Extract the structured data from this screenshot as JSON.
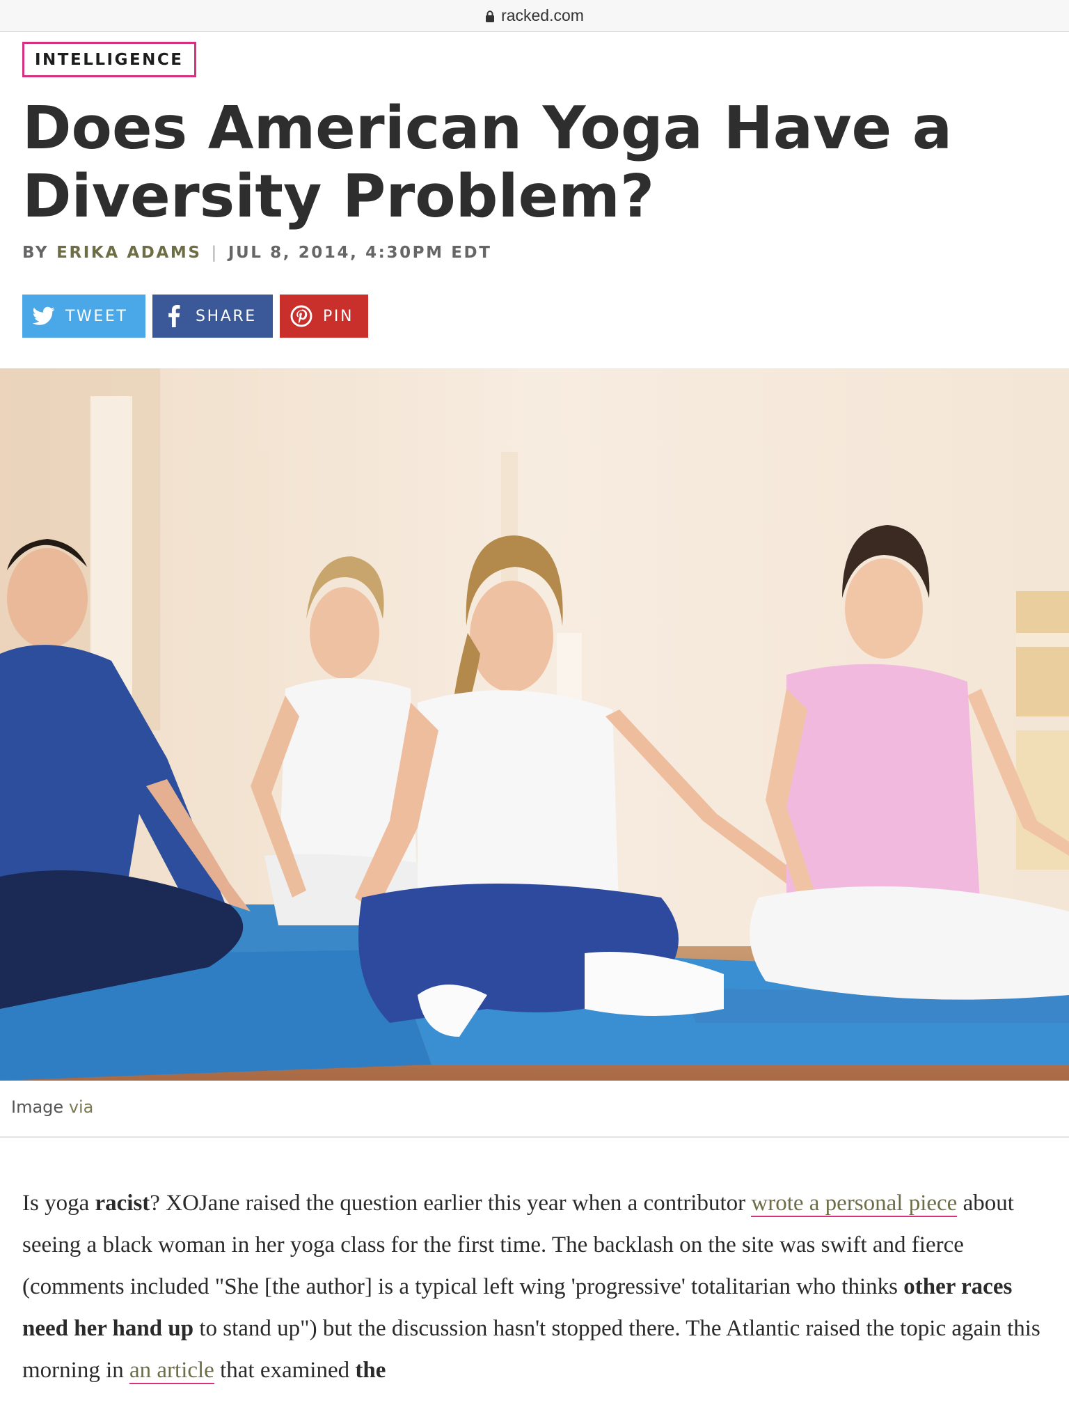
{
  "browser": {
    "url": "racked.com",
    "lock_icon": "lock-icon"
  },
  "article": {
    "category": "INTELLIGENCE",
    "headline": "Does American Yoga Have a Diversity Problem?",
    "byline_prefix": "BY",
    "author": "ERIKA ADAMS",
    "separator": "|",
    "date": "JUL 8, 2014, 4:30PM EDT"
  },
  "share": {
    "tweet_label": "TWEET",
    "share_label": "SHARE",
    "pin_label": "PIN",
    "colors": {
      "tweet": "#4aa8e8",
      "share": "#3b5998",
      "pin": "#c9302c"
    },
    "icons": {
      "tweet": "twitter-bird-icon",
      "share": "facebook-f-icon",
      "pin": "pinterest-p-icon"
    }
  },
  "hero_image": {
    "description_icon": "yoga-class-photo"
  },
  "caption": {
    "label": "Image",
    "link": "via"
  },
  "body": {
    "p1_a": "Is yoga ",
    "p1_b": "racist",
    "p1_c": "? XOJane raised the question earlier this year when a contributor ",
    "p1_link1": "wrote a personal piece",
    "p1_d": " about seeing a black woman in her yoga class for the first time. The backlash on the site was swift and fierce (comments included \"She [the author] is a typical left wing 'progressive' totalitarian who thinks ",
    "p1_e": "other races need her hand up",
    "p1_f": " to stand up\") but the discussion hasn't stopped there. The Atlantic raised the topic again this morning in ",
    "p1_link2": "an article",
    "p1_g": " that examined ",
    "p1_h": "the"
  },
  "accent_color": "#d6317e"
}
